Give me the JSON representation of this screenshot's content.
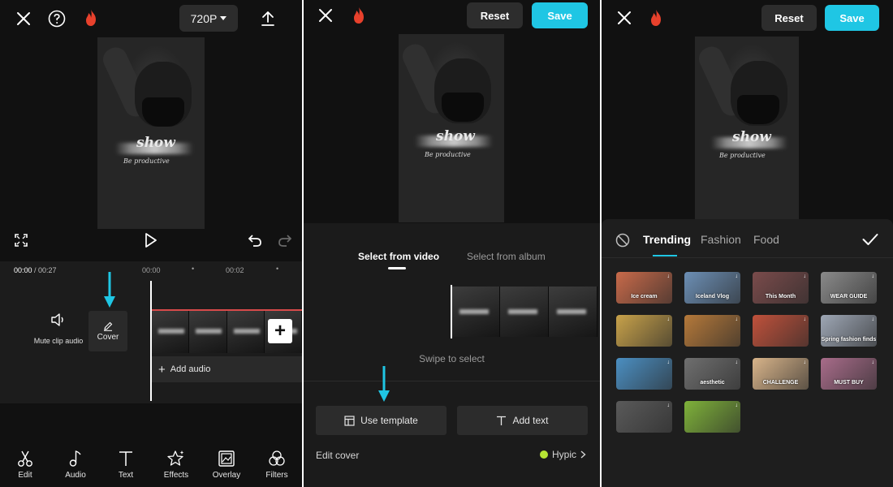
{
  "panel1": {
    "resolution": "720P",
    "timecode_current": "00:00",
    "timecode_total": " / 00:27",
    "timeline_marks": [
      "00:00",
      "00:02"
    ],
    "mute_label": "Mute clip audio",
    "cover_label": "Cover",
    "add_audio_label": "Add audio",
    "add_clip_symbol": "+",
    "bottom_tools": [
      {
        "label": "Edit",
        "icon": "scissors-icon"
      },
      {
        "label": "Audio",
        "icon": "music-note-icon"
      },
      {
        "label": "Text",
        "icon": "text-icon"
      },
      {
        "label": "Effects",
        "icon": "effects-star-icon"
      },
      {
        "label": "Overlay",
        "icon": "overlay-icon"
      },
      {
        "label": "Filters",
        "icon": "filters-icon"
      }
    ]
  },
  "preview": {
    "title_text": "show",
    "subtitle_text": "Be productive"
  },
  "panel2": {
    "reset_label": "Reset",
    "save_label": "Save",
    "tab_video": "Select from video",
    "tab_album": "Select from album",
    "swipe_hint": "Swipe to select",
    "use_template_label": "Use template",
    "add_text_label": "Add text",
    "edit_cover_label": "Edit cover",
    "hypic_label": "Hypic"
  },
  "panel3": {
    "reset_label": "Reset",
    "save_label": "Save",
    "tabs": [
      "Trending",
      "Fashion",
      "Food"
    ],
    "active_tab": "Trending",
    "templates": [
      {
        "label": "Ice cream",
        "bg": "#c86a4a"
      },
      {
        "label": "Iceland Vlog",
        "bg": "#6c8fb5"
      },
      {
        "label": "This Month",
        "bg": "#7a4b4b"
      },
      {
        "label": "WEAR GUIDE",
        "bg": "#8a8a8a"
      },
      {
        "label": "",
        "bg": "#c8a24a"
      },
      {
        "label": "",
        "bg": "#b5793a"
      },
      {
        "label": "",
        "bg": "#c0513b"
      },
      {
        "label": "Spring fashion finds",
        "bg": "#9ea7b5"
      },
      {
        "label": "",
        "bg": "#4b8fc2"
      },
      {
        "label": "aesthetic",
        "bg": "#6f6f6f"
      },
      {
        "label": "CHALLENGE",
        "bg": "#d8b48a"
      },
      {
        "label": "MUST BUY",
        "bg": "#a86c8a"
      },
      {
        "label": "",
        "bg": "#5a5a5a"
      },
      {
        "label": "",
        "bg": "#7fb23a"
      }
    ]
  },
  "colors": {
    "accent": "#1fc6e4",
    "flame": "#e8412c",
    "background": "#111111"
  }
}
